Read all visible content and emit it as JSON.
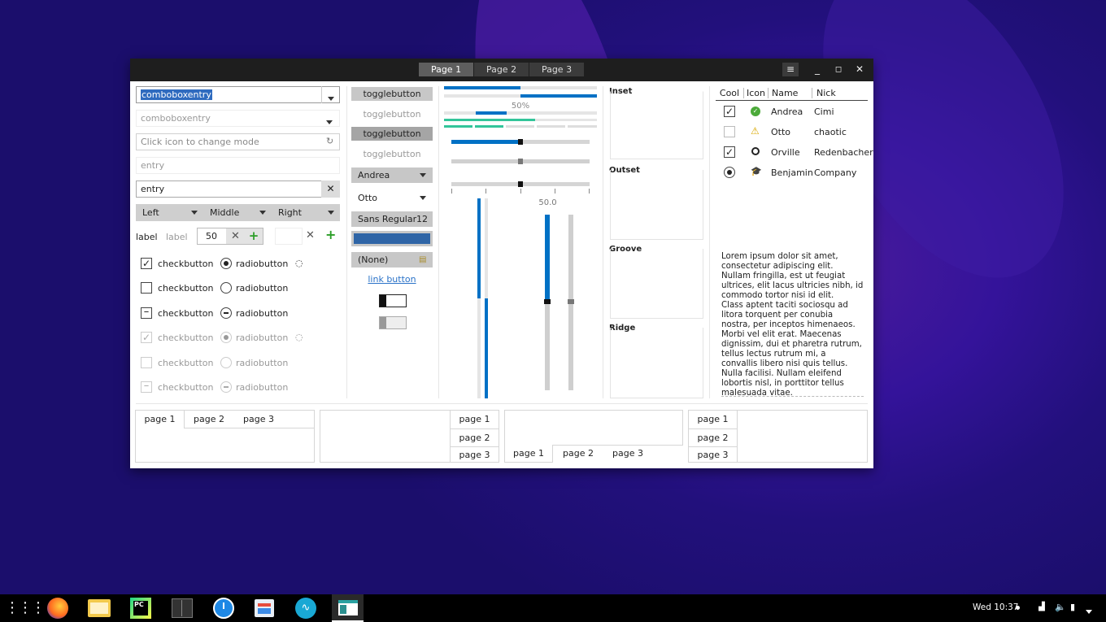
{
  "titlebar": {
    "tabs": [
      "Page 1",
      "Page 2",
      "Page 3"
    ],
    "menu_icon": "hamburger-icon"
  },
  "left": {
    "combo1": "comboboxentry",
    "combo2": "comboboxentry",
    "mode_placeholder": "Click icon to change mode",
    "entry_placeholder": "entry",
    "entry_value": "entry",
    "alignment": [
      "Left",
      "Middle",
      "Right"
    ],
    "label_bold": "label",
    "label_dim": "label",
    "spin_value": "50",
    "checks": [
      "checkbutton",
      "checkbutton",
      "checkbutton",
      "checkbutton",
      "checkbutton",
      "checkbutton"
    ],
    "radios": [
      "radiobutton",
      "radiobutton",
      "radiobutton",
      "radiobutton",
      "radiobutton",
      "radiobutton"
    ]
  },
  "mid": {
    "toggles": [
      "togglebutton",
      "togglebutton",
      "togglebutton",
      "togglebutton"
    ],
    "combo_a": "Andrea",
    "combo_b": "Otto",
    "font_name": "Sans Regular",
    "font_size": "12",
    "color_value": "#2f65a6",
    "file_none": "(None)",
    "link": "link button"
  },
  "scales": {
    "progress_text": "50%",
    "progress_value": 0.5,
    "scale_value_text": "50.0",
    "h_scale_value": 0.5
  },
  "frames": [
    "Inset",
    "Outset",
    "Groove",
    "Ridge"
  ],
  "tree": {
    "columns": [
      "Cool",
      "Icon",
      "Name",
      "Nick"
    ],
    "rows": [
      {
        "name": "Andrea",
        "nick": "Cimi",
        "icon": "ok-icon"
      },
      {
        "name": "Otto",
        "nick": "chaotic",
        "icon": "warning-icon"
      },
      {
        "name": "Orville",
        "nick": "Redenbacher",
        "icon": "circle-icon"
      },
      {
        "name": "Benjamin",
        "nick": "Company",
        "icon": "cap-icon"
      }
    ]
  },
  "lorem": "Lorem ipsum dolor sit amet, consectetur adipiscing elit.\nNullam fringilla, est ut feugiat ultrices, elit lacus ultricies nibh, id commodo tortor nisi id elit.\nClass aptent taciti sociosqu ad litora torquent per conubia nostra, per inceptos himenaeos.\nMorbi vel elit erat. Maecenas dignissim, dui et pharetra rutrum, tellus lectus rutrum mi, a convallis libero nisi quis tellus.\nNulla facilisi. Nullam eleifend lobortis nisl, in porttitor tellus malesuada vitae.",
  "notebooks": {
    "nb1": [
      "page 1",
      "page 2",
      "page 3"
    ],
    "nb2": [
      "page 1",
      "page 2",
      "page 3"
    ],
    "nb3": [
      "page 1",
      "page 2",
      "page 3"
    ],
    "nb4": [
      "page 1",
      "page 2",
      "page 3"
    ]
  },
  "taskbar": {
    "clock": "Wed 10:37",
    "apps": [
      "apps-grid-icon",
      "firefox-icon",
      "files-icon",
      "pycharm-icon",
      "terminal-icon",
      "clock-icon",
      "store-icon",
      "audio-icon",
      "gtk-demo-icon"
    ]
  },
  "colors": {
    "accent": "#0071c5",
    "titlebar": "#1e1e1e",
    "taskbar": "#000000"
  }
}
